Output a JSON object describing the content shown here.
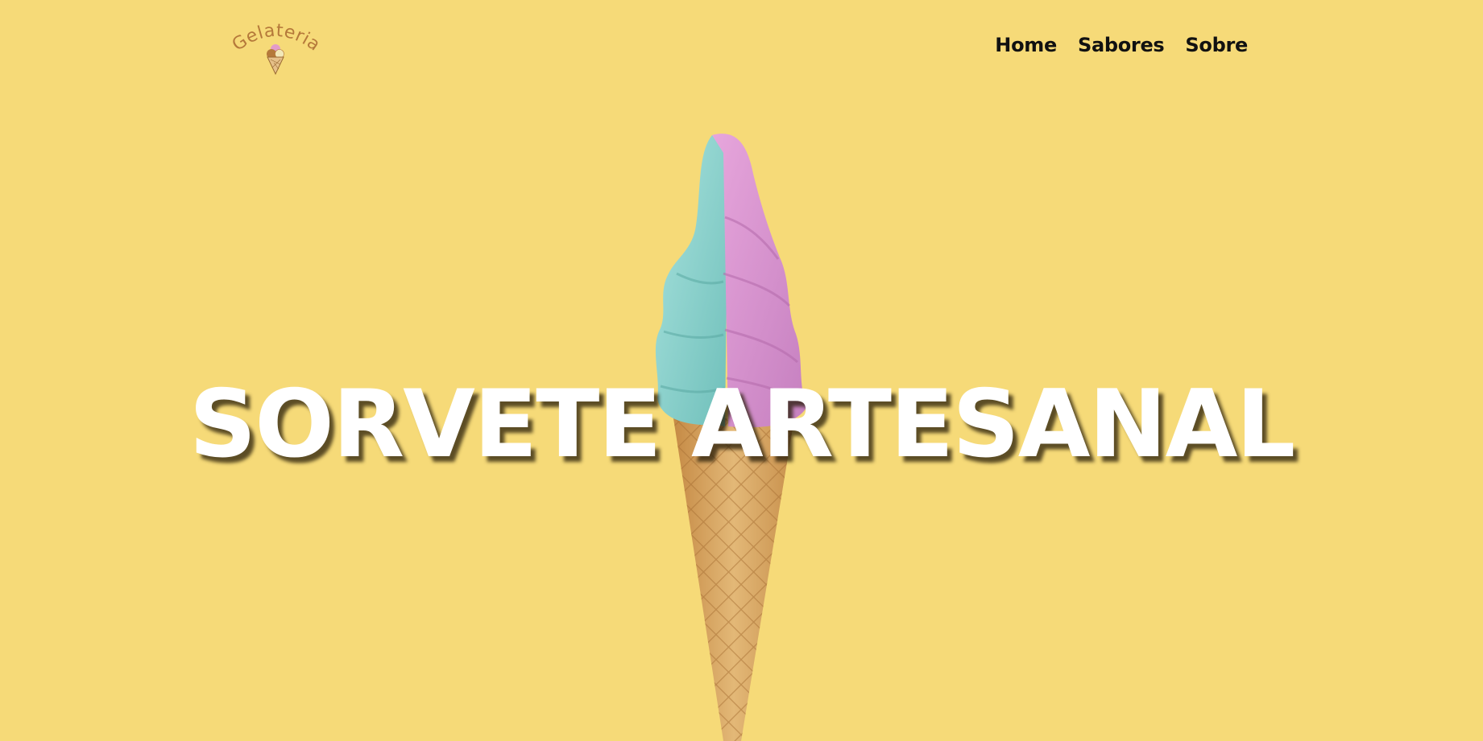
{
  "header": {
    "logo_text": "Gelateria",
    "nav": [
      {
        "label": "Home"
      },
      {
        "label": "Sabores"
      },
      {
        "label": "Sobre"
      }
    ]
  },
  "hero": {
    "title": "SORVETE ARTESANAL",
    "image": "ice-cream-cone-photo"
  },
  "colors": {
    "background": "#f6da78",
    "logo_text": "#b5793a",
    "nav_text": "#111111",
    "hero_text": "#ffffff",
    "ice_cream_pink": "#d792cf",
    "ice_cream_mint": "#8fd3cf",
    "cone": "#d9a65e"
  }
}
